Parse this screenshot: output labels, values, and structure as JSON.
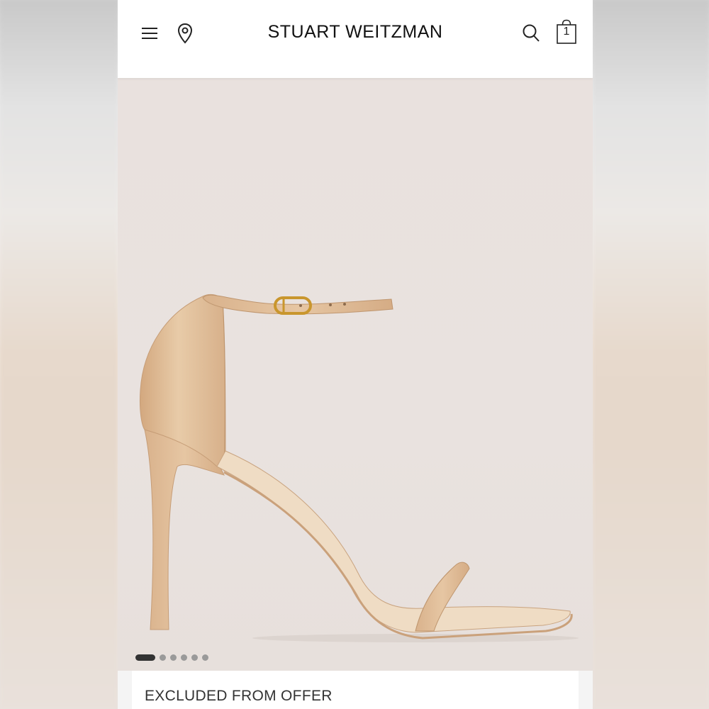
{
  "header": {
    "brand": "STUART WEITZMAN",
    "menu_icon": "hamburger-menu-icon",
    "location_icon": "map-pin-icon",
    "search_icon": "search-icon",
    "bag_icon": "shopping-bag-icon",
    "bag_count": "1"
  },
  "gallery": {
    "image_alt": "Nude leather ankle-strap high heel sandal",
    "slide_count": 6,
    "active_slide": 1
  },
  "promo": {
    "label": "EXCLUDED FROM OFFER"
  },
  "colors": {
    "text": "#111111",
    "hero_background": "#e9e1de",
    "product": "#dcb590",
    "buckle": "#c9962d"
  }
}
